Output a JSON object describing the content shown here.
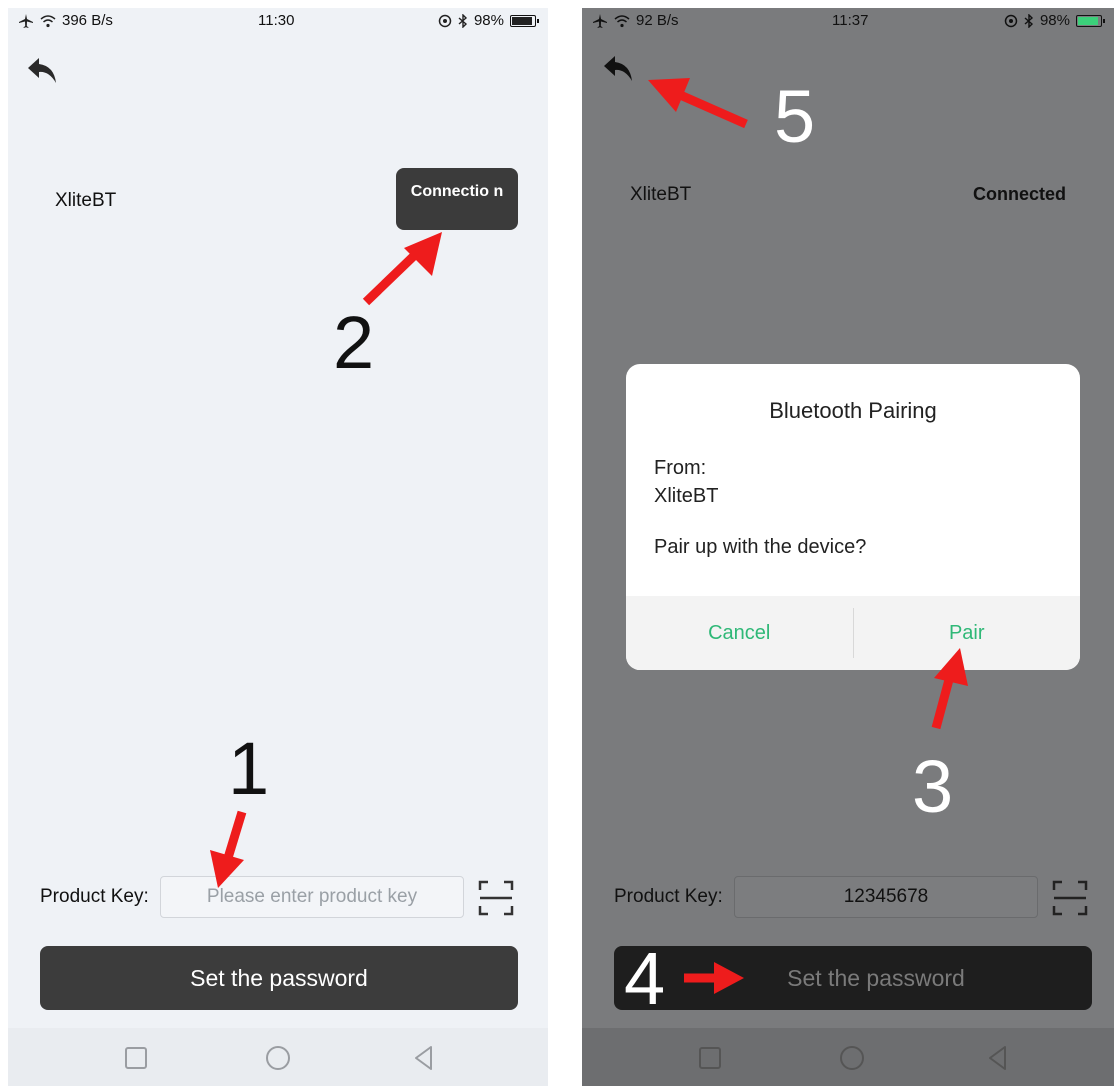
{
  "left": {
    "status": {
      "speed": "396 B/s",
      "time": "11:30",
      "battery": "98%",
      "battery_level": 0.98
    },
    "device_name": "XliteBT",
    "connection_button": "Connectio n",
    "product_key_label": "Product Key:",
    "product_key_placeholder": "Please enter product key",
    "set_password_button": "Set the password",
    "annotations": {
      "step1": "1",
      "step2": "2"
    }
  },
  "right": {
    "status": {
      "speed": "92 B/s",
      "time": "11:37",
      "battery": "98%",
      "battery_level": 0.98
    },
    "device_name": "XliteBT",
    "connection_status": "Connected",
    "dialog": {
      "title": "Bluetooth Pairing",
      "from_label": "From:",
      "from_device": "XliteBT",
      "message": "Pair up with the device?",
      "cancel": "Cancel",
      "pair": "Pair"
    },
    "product_key_label": "Product Key:",
    "product_key_value": "12345678",
    "set_password_button": "Set the password",
    "annotations": {
      "step3": "3",
      "step4": "4",
      "step5": "5"
    }
  },
  "colors": {
    "accent_green": "#2fb877",
    "annotation_red": "#ee1c1c",
    "dark_button": "#3c3c3c"
  }
}
